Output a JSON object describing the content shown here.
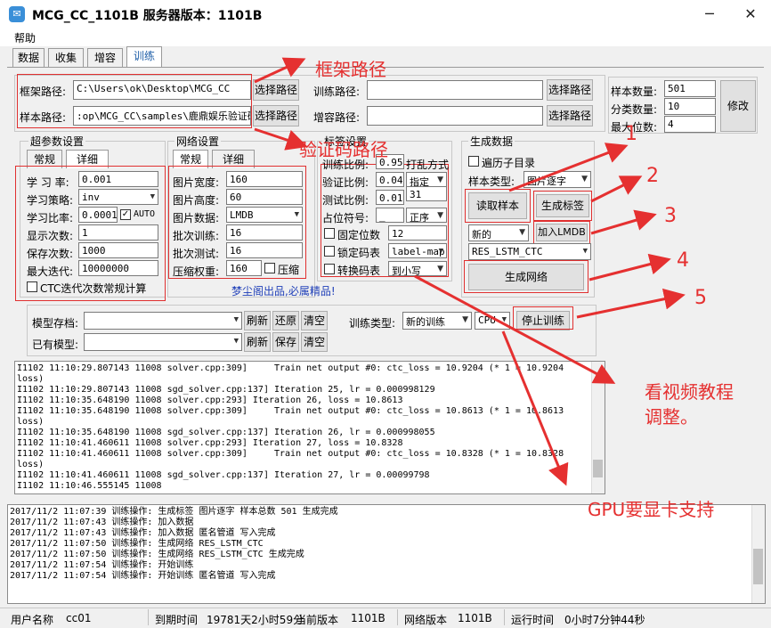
{
  "window": {
    "title": "MCG_CC_1101B 服务器版本：1101B",
    "icon": "app-chat-icon"
  },
  "menu": {
    "help": "帮助"
  },
  "tabs": [
    "数据",
    "收集",
    "增容",
    "训练"
  ],
  "paths": {
    "frame_label": "框架路径:",
    "frame_value": "C:\\Users\\ok\\Desktop\\MCG_CC",
    "sample_label": "样本路径:",
    "sample_value": ":op\\MCG_CC\\samples\\鹿鼎娱乐验证码",
    "train_label": "训练路径:",
    "train_value": "",
    "aug_label": "增容路径:",
    "aug_value": "",
    "select": "选择路径"
  },
  "stats": {
    "sample_count_label": "样本数量:",
    "sample_count": "501",
    "class_count_label": "分类数量:",
    "class_count": "10",
    "max_digits_label": "最大位数:",
    "max_digits": "4",
    "modify": "修改"
  },
  "hyper": {
    "title": "超参数设置",
    "tab_normal": "常规",
    "tab_detail": "详细",
    "lr_label": "学 习 率:",
    "lr": "0.001",
    "policy_label": "学习策略:",
    "policy": "inv",
    "ratio_label": "学习比率:",
    "ratio": "0.0001",
    "auto": "AUTO",
    "display_label": "显示次数:",
    "display": "1",
    "save_label": "保存次数:",
    "save": "1000",
    "iter_label": "最大迭代:",
    "iter": "10000000",
    "ctc_check": "CTC迭代次数常规计算"
  },
  "net": {
    "title": "网络设置",
    "tab_normal": "常规",
    "tab_detail": "详细",
    "width_label": "图片宽度:",
    "width": "160",
    "height_label": "图片高度:",
    "height": "60",
    "data_label": "图片数据:",
    "data": "LMDB",
    "train_batch_label": "批次训练:",
    "train_batch": "16",
    "test_batch_label": "批次测试:",
    "test_batch": "16",
    "compress_label": "压缩权重:",
    "compress": "160",
    "compress_check": "压缩",
    "footer": "梦尘阁出品,必属精品!"
  },
  "label": {
    "title": "标签设置",
    "train_ratio_label": "训练比例:",
    "train_ratio": "0.95",
    "shuffle": "打乱方式",
    "val_ratio_label": "验证比例:",
    "val_ratio": "0.04",
    "shuffle_mode": "指定",
    "test_ratio_label": "测试比例:",
    "test_ratio": "0.01",
    "seed": "31",
    "placeholder_label": "占位符号:",
    "placeholder": "_",
    "order": "正序",
    "fixed_digits": "固定位数",
    "fixed_value": "12",
    "lock_table": "锁定码表",
    "lock_value": "label-map",
    "convert_table": "转换码表",
    "convert_value": "到小写"
  },
  "gen": {
    "title": "生成数据",
    "traverse": "遍历子目录",
    "sample_type_label": "样本类型:",
    "sample_type": "图片逐字",
    "read_sample": "读取样本",
    "gen_label": "生成标签",
    "mode": "新的",
    "add_lmdb": "加入LMDB",
    "net_type": "RES_LSTM_CTC",
    "gen_net": "生成网络"
  },
  "model": {
    "store_label": "模型存档:",
    "store_value": "",
    "refresh": "刷新",
    "restore": "还原",
    "clear": "清空",
    "train_type_label": "训练类型:",
    "train_type": "新的训练",
    "device": "CPU",
    "stop": "停止训练",
    "existing_label": "已有模型:",
    "existing_value": "",
    "save": "保存"
  },
  "train_log": [
    "I1102 11:10:29.807143 11008 solver.cpp:309]     Train net output #0: ctc_loss = 10.9204 (* 1 = 10.9204",
    "loss)",
    "I1102 11:10:29.807143 11008 sgd_solver.cpp:137] Iteration 25, lr = 0.000998129",
    "I1102 11:10:35.648190 11008 solver.cpp:293] Iteration 26, loss = 10.8613",
    "I1102 11:10:35.648190 11008 solver.cpp:309]     Train net output #0: ctc_loss = 10.8613 (* 1 = 10.8613",
    "loss)",
    "I1102 11:10:35.648190 11008 sgd_solver.cpp:137] Iteration 26, lr = 0.000998055",
    "I1102 11:10:41.460611 11008 solver.cpp:293] Iteration 27, loss = 10.8328",
    "I1102 11:10:41.460611 11008 solver.cpp:309]     Train net output #0: ctc_loss = 10.8328 (* 1 = 10.8328",
    "loss)",
    "I1102 11:10:41.460611 11008 sgd_solver.cpp:137] Iteration 27, lr = 0.00099798",
    "I1102 11:10:46.555145 11008"
  ],
  "op_log": [
    "2017/11/2 11:07:39 训练操作: 生成标签 图片逐字 样本总数 501 生成完成",
    "2017/11/2 11:07:43 训练操作: 加入数据",
    "2017/11/2 11:07:43 训练操作: 加入数据 匿名管道 写入完成",
    "2017/11/2 11:07:50 训练操作: 生成网络 RES_LSTM_CTC",
    "2017/11/2 11:07:50 训练操作: 生成网络 RES_LSTM_CTC 生成完成",
    "2017/11/2 11:07:54 训练操作: 开始训练",
    "2017/11/2 11:07:54 训练操作: 开始训练 匿名管道 写入完成"
  ],
  "status": {
    "user_label": "用户名称",
    "user": "cc01",
    "expire_label": "到期时间",
    "expire": "19781天2小时59分",
    "cur_ver_label": "当前版本",
    "cur_ver": "1101B",
    "net_ver_label": "网络版本",
    "net_ver": "1101B",
    "run_label": "运行时间",
    "run": "0小时7分钟44秒"
  },
  "annotations": {
    "frame_path": "框架路径",
    "verify_path": "验证码路径",
    "n1": "1",
    "n2": "2",
    "n3": "3",
    "n4": "4",
    "n5": "5",
    "video": "看视频教程",
    "video2": "调整。",
    "gpu": "GPU要显卡支持"
  },
  "colors": {
    "annotation": "#e53030",
    "footer_link": "#1f3fb8",
    "tab_active": "#1f5fa8"
  }
}
